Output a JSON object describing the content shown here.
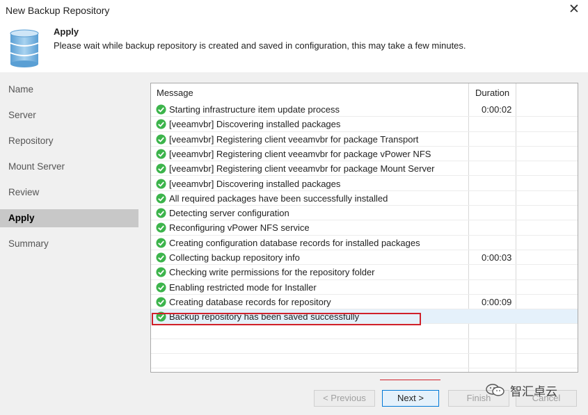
{
  "window": {
    "title": "New Backup Repository",
    "close_glyph": "✕"
  },
  "header": {
    "title": "Apply",
    "description": "Please wait while backup repository is created and saved in configuration, this may take a few minutes.",
    "icon": "database-icon"
  },
  "sidebar": {
    "items": [
      {
        "label": "Name",
        "active": false
      },
      {
        "label": "Server",
        "active": false
      },
      {
        "label": "Repository",
        "active": false
      },
      {
        "label": "Mount Server",
        "active": false
      },
      {
        "label": "Review",
        "active": false
      },
      {
        "label": "Apply",
        "active": true
      },
      {
        "label": "Summary",
        "active": false
      }
    ]
  },
  "log": {
    "columns": {
      "message": "Message",
      "duration": "Duration"
    },
    "rows": [
      {
        "message": "Starting infrastructure item update process",
        "duration": "0:00:02"
      },
      {
        "message": "[veeamvbr] Discovering installed packages",
        "duration": ""
      },
      {
        "message": "[veeamvbr] Registering client veeamvbr for package Transport",
        "duration": ""
      },
      {
        "message": "[veeamvbr] Registering client veeamvbr for package vPower NFS",
        "duration": ""
      },
      {
        "message": "[veeamvbr] Registering client veeamvbr for package Mount Server",
        "duration": ""
      },
      {
        "message": "[veeamvbr] Discovering installed packages",
        "duration": ""
      },
      {
        "message": "All required packages have been successfully installed",
        "duration": ""
      },
      {
        "message": "Detecting server configuration",
        "duration": ""
      },
      {
        "message": "Reconfiguring vPower NFS service",
        "duration": ""
      },
      {
        "message": "Creating configuration database records for installed packages",
        "duration": ""
      },
      {
        "message": "Collecting backup repository info",
        "duration": "0:00:03"
      },
      {
        "message": "Checking write permissions for the repository folder",
        "duration": ""
      },
      {
        "message": "Enabling restricted mode for Installer",
        "duration": ""
      },
      {
        "message": "Creating database records for repository",
        "duration": "0:00:09"
      },
      {
        "message": "Backup repository has been saved successfully",
        "duration": ""
      }
    ],
    "status_icon": "success-check-icon",
    "status_color": "#3cb44b"
  },
  "footer": {
    "previous_label": "< Previous",
    "next_label": "Next >",
    "finish_label": "Finish",
    "cancel_label": "Cancel"
  },
  "watermark": {
    "text": "智汇卓云",
    "icon": "wechat-icon"
  },
  "colors": {
    "highlight_box": "#d0202a",
    "accent": "#0078d7"
  }
}
